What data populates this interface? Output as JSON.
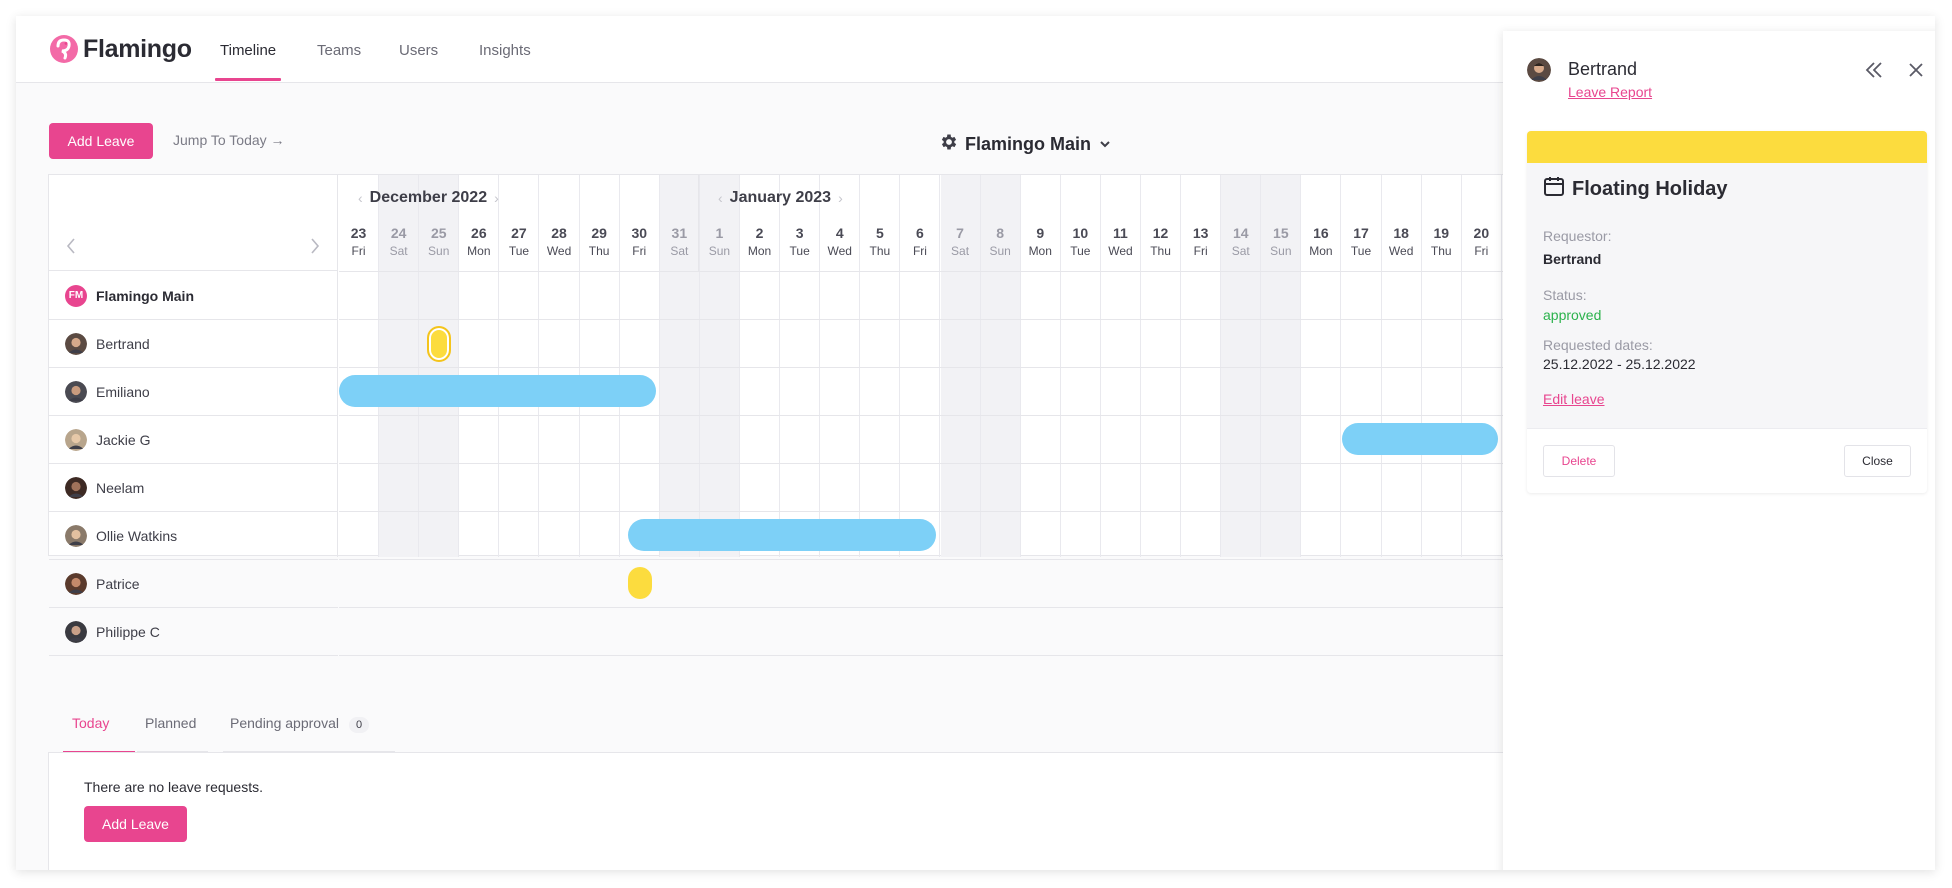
{
  "app": {
    "name": "Flamingo"
  },
  "nav": {
    "tabs": [
      "Timeline",
      "Teams",
      "Users",
      "Insights"
    ],
    "active": "Timeline"
  },
  "toolbar": {
    "add_leave": "Add Leave",
    "jump_today": "Jump To Today →",
    "calendar": "Flamingo Main"
  },
  "timeline": {
    "months": [
      "December 2022",
      "January 2023"
    ],
    "days": [
      {
        "d": "23",
        "w": "Fri",
        "weekend": false
      },
      {
        "d": "24",
        "w": "Sat",
        "weekend": true
      },
      {
        "d": "25",
        "w": "Sun",
        "weekend": true
      },
      {
        "d": "26",
        "w": "Mon",
        "weekend": false
      },
      {
        "d": "27",
        "w": "Tue",
        "weekend": false
      },
      {
        "d": "28",
        "w": "Wed",
        "weekend": false
      },
      {
        "d": "29",
        "w": "Thu",
        "weekend": false
      },
      {
        "d": "30",
        "w": "Fri",
        "weekend": false
      },
      {
        "d": "31",
        "w": "Sat",
        "weekend": true
      },
      {
        "d": "1",
        "w": "Sun",
        "weekend": true
      },
      {
        "d": "2",
        "w": "Mon",
        "weekend": false
      },
      {
        "d": "3",
        "w": "Tue",
        "weekend": false
      },
      {
        "d": "4",
        "w": "Wed",
        "weekend": false
      },
      {
        "d": "5",
        "w": "Thu",
        "weekend": false
      },
      {
        "d": "6",
        "w": "Fri",
        "weekend": false
      },
      {
        "d": "7",
        "w": "Sat",
        "weekend": true
      },
      {
        "d": "8",
        "w": "Sun",
        "weekend": true
      },
      {
        "d": "9",
        "w": "Mon",
        "weekend": false
      },
      {
        "d": "10",
        "w": "Tue",
        "weekend": false
      },
      {
        "d": "11",
        "w": "Wed",
        "weekend": false
      },
      {
        "d": "12",
        "w": "Thu",
        "weekend": false
      },
      {
        "d": "13",
        "w": "Fri",
        "weekend": false
      },
      {
        "d": "14",
        "w": "Sat",
        "weekend": true
      },
      {
        "d": "15",
        "w": "Sun",
        "weekend": true
      },
      {
        "d": "16",
        "w": "Mon",
        "weekend": false
      },
      {
        "d": "17",
        "w": "Tue",
        "weekend": false
      },
      {
        "d": "18",
        "w": "Wed",
        "weekend": false
      },
      {
        "d": "19",
        "w": "Thu",
        "weekend": false
      },
      {
        "d": "20",
        "w": "Fri",
        "weekend": false
      }
    ],
    "team": {
      "initials": "FM",
      "name": "Flamingo Main"
    },
    "users": [
      "Bertrand",
      "Emiliano",
      "Jackie G",
      "Neelam",
      "Ollie Watkins",
      "Patrice",
      "Philippe C"
    ],
    "leaves": [
      {
        "user": "Bertrand",
        "start": "25.12.2022",
        "end": "25.12.2022",
        "type": "Floating Holiday",
        "color": "#fcdc3e",
        "selected": true
      },
      {
        "user": "Emiliano",
        "start": "23.12.2022",
        "end": "30.12.2022",
        "type": "",
        "color": "#7dd0f7"
      },
      {
        "user": "Jackie G",
        "start": "17.01.2023",
        "end": "20.01.2023",
        "type": "",
        "color": "#7dd0f7"
      },
      {
        "user": "Ollie Watkins",
        "start": "30.12.2022",
        "end": "06.01.2023",
        "type": "",
        "color": "#7dd0f7"
      },
      {
        "user": "Patrice",
        "start": "30.12.2022",
        "end": "30.12.2022",
        "type": "",
        "color": "#fcdc3e"
      }
    ]
  },
  "bottom": {
    "tabs": [
      "Today",
      "Planned",
      "Pending approval"
    ],
    "pending_count": "0",
    "empty_text": "There are no leave requests.",
    "add_leave": "Add Leave"
  },
  "panel": {
    "user": "Bertrand",
    "report_link": "Leave Report",
    "leave_type": "Floating Holiday",
    "requestor_label": "Requestor:",
    "requestor": "Bertrand",
    "status_label": "Status:",
    "status": "approved",
    "dates_label": "Requested dates:",
    "dates": "25.12.2022 - 25.12.2022",
    "edit": "Edit leave",
    "delete": "Delete",
    "close": "Close"
  },
  "colors": {
    "accent": "#e8458f",
    "status_approved": "#2bb24c",
    "leave_blue": "#7dd0f7",
    "leave_yellow": "#fcdc3e"
  },
  "icons": {
    "logo": "flamingo-logo",
    "gear": "gear-icon",
    "calendar": "calendar-icon",
    "collapse": "double-chevron-left-icon",
    "close": "close-icon"
  }
}
